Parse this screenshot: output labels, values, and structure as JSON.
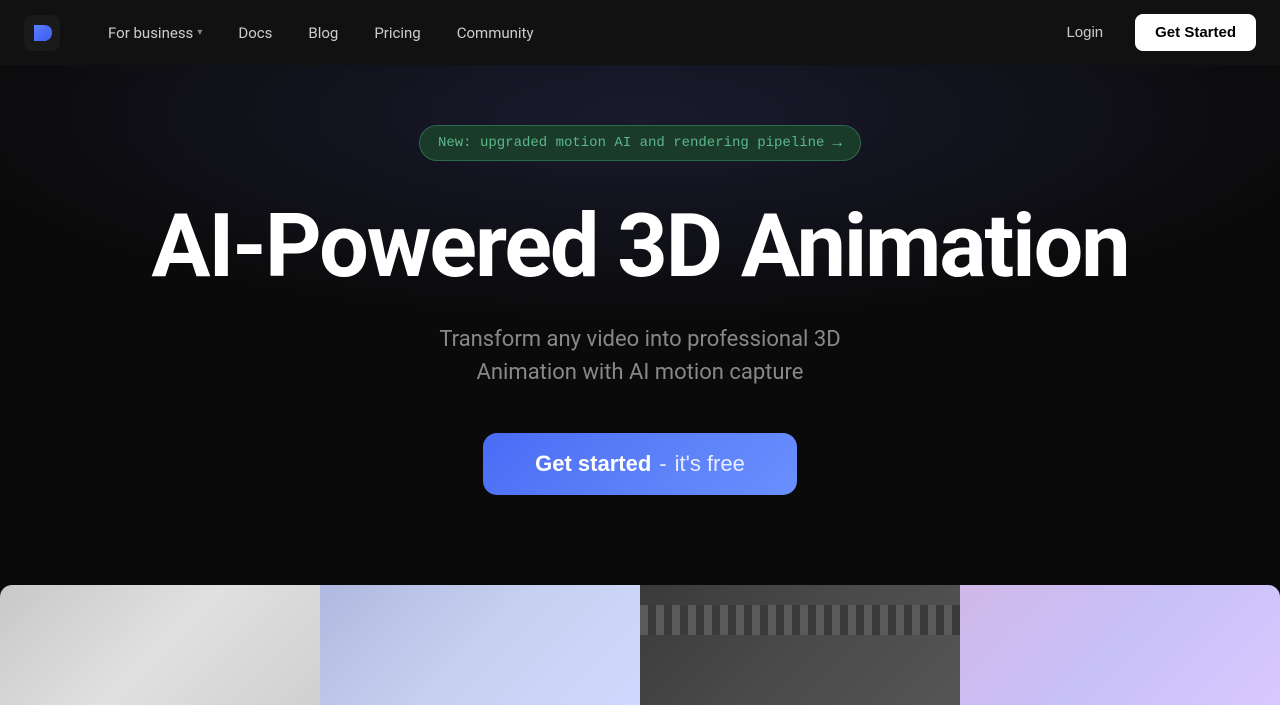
{
  "nav": {
    "logo_alt": "Plask logo",
    "links": [
      {
        "id": "for-business",
        "label": "For business",
        "has_dropdown": true
      },
      {
        "id": "docs",
        "label": "Docs",
        "has_dropdown": false
      },
      {
        "id": "blog",
        "label": "Blog",
        "has_dropdown": false
      },
      {
        "id": "pricing",
        "label": "Pricing",
        "has_dropdown": false
      },
      {
        "id": "community",
        "label": "Community",
        "has_dropdown": false
      }
    ],
    "login_label": "Login",
    "get_started_label": "Get Started"
  },
  "hero": {
    "badge_text": "New: upgraded motion AI and rendering pipeline",
    "badge_arrow": "→",
    "title": "AI-Powered 3D Animation",
    "subtitle_line1": "Transform any video into professional 3D",
    "subtitle_line2": "Animation with AI motion capture",
    "cta_bold": "Get started",
    "cta_separator": " - ",
    "cta_light": "it's free"
  },
  "colors": {
    "nav_bg": "#111111",
    "body_bg": "#0a0a0a",
    "badge_bg": "#1a3a2a",
    "badge_border": "#2d6a4a",
    "badge_text": "#5cb888",
    "cta_bg_start": "#4a6cf7",
    "cta_bg_end": "#6a8fff",
    "get_started_bg": "#ffffff",
    "get_started_text": "#000000"
  }
}
